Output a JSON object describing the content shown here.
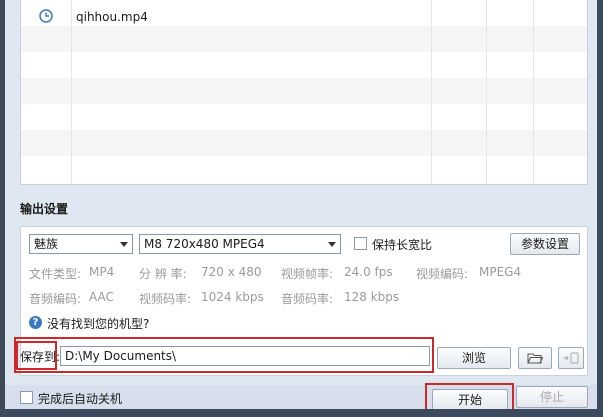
{
  "file_list": {
    "file_name": "qihhou.mp4",
    "icon": "clock-icon"
  },
  "output": {
    "section_title": "输出设置",
    "brand_select": "魅族",
    "model_select": "M8 720x480 MPEG4",
    "keep_ratio_label": "保持长宽比",
    "params_button": "参数设置",
    "info_row1": [
      {
        "label": "文件类型:",
        "value": "MP4"
      },
      {
        "label": "分 辨 率:",
        "value": "720 x 480"
      },
      {
        "label": "视频帧率:",
        "value": "24.0 fps"
      },
      {
        "label": "视频编码:",
        "value": "MPEG4"
      }
    ],
    "info_row2": [
      {
        "label": "音频编码:",
        "value": "AAC"
      },
      {
        "label": "视频码率:",
        "value": "1024 kbps"
      },
      {
        "label": "音频码率:",
        "value": "128 kbps"
      }
    ],
    "help_link": "没有找到您的机型?",
    "save_to_label": "保存到:",
    "save_path": "D:\\My Documents\\",
    "browse_button": "浏览"
  },
  "footer": {
    "auto_shutdown_label": "完成后自动关机",
    "start_button": "开始",
    "stop_button": "停止"
  },
  "colors": {
    "highlight": "#cc2a2a",
    "link_icon": "#3b78c4"
  }
}
